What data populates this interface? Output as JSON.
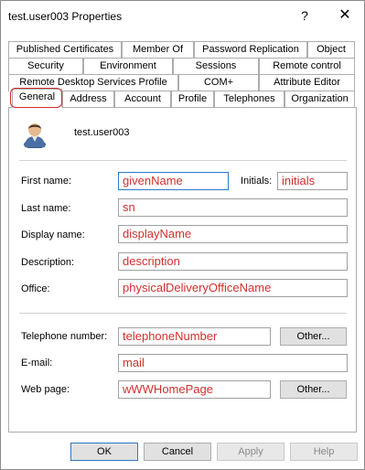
{
  "window": {
    "title": "test.user003 Properties",
    "help_glyph": "?",
    "close_glyph": "✕"
  },
  "tabs": {
    "row1": [
      "Published Certificates",
      "Member Of",
      "Password Replication",
      "Object"
    ],
    "row2": [
      "Security",
      "Environment",
      "Sessions",
      "Remote control"
    ],
    "row3": [
      "Remote Desktop Services Profile",
      "COM+",
      "Attribute Editor"
    ],
    "row4": [
      "General",
      "Address",
      "Account",
      "Profile",
      "Telephones",
      "Organization"
    ],
    "active": "General"
  },
  "user": {
    "name": "test.user003",
    "avatar_icon": "user-icon"
  },
  "form": {
    "first_name": {
      "label": "First name:",
      "value": "givenName"
    },
    "initials": {
      "label": "Initials:",
      "value": "initials"
    },
    "last_name": {
      "label": "Last name:",
      "value": "sn"
    },
    "display_name": {
      "label": "Display name:",
      "value": "displayName"
    },
    "description": {
      "label": "Description:",
      "value": "description"
    },
    "office": {
      "label": "Office:",
      "value": "physicalDeliveryOfficeName"
    },
    "telephone": {
      "label": "Telephone number:",
      "value": "telephoneNumber",
      "other_label": "Other..."
    },
    "email": {
      "label": "E-mail:",
      "value": "mail"
    },
    "web_page": {
      "label": "Web page:",
      "value": "wWWHomePage",
      "other_label": "Other..."
    }
  },
  "buttons": {
    "ok": "OK",
    "cancel": "Cancel",
    "apply": "Apply",
    "help": "Help"
  },
  "colors": {
    "field_text": "#d32f2f",
    "annotation": "#d02a2a",
    "focus": "#2b79c8"
  }
}
